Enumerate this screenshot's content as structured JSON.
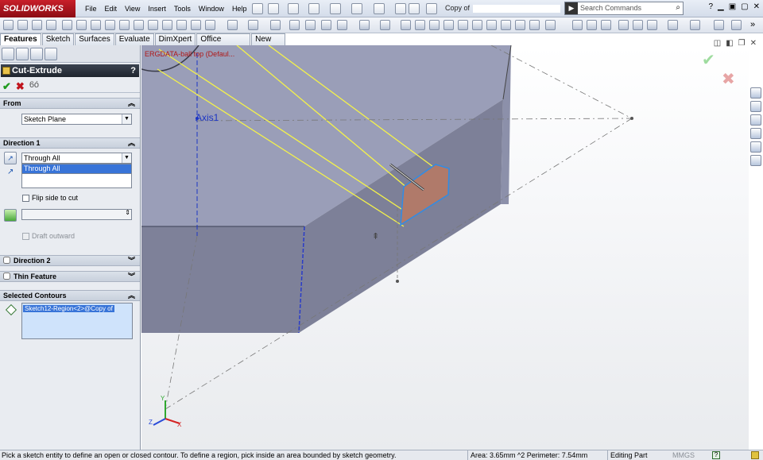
{
  "app": {
    "logo": "SOLIDWORKS",
    "menu": [
      "File",
      "Edit",
      "View",
      "Insert",
      "Tools",
      "Window",
      "Help"
    ],
    "document_title": "Copy of",
    "search_placeholder": "Search Commands"
  },
  "command_tabs": [
    "Features",
    "Sketch",
    "Surfaces",
    "Evaluate",
    "DimXpert",
    "Office Products",
    "New Tab"
  ],
  "property_manager": {
    "title": "Cut-Extrude",
    "help": "?",
    "from": {
      "heading": "From",
      "value": "Sketch Plane"
    },
    "direction1": {
      "heading": "Direction 1",
      "end_condition": "Through All",
      "dropdown_selected": "Through All",
      "flip_label": "Flip side to cut",
      "draft_label": "Draft outward"
    },
    "direction2": {
      "heading": "Direction 2"
    },
    "thin_feature": {
      "heading": "Thin Feature"
    },
    "selected_contours": {
      "heading": "Selected Contours",
      "items": [
        "Sketch12-Region<2>@Copy of"
      ]
    }
  },
  "graphics": {
    "tree_label": "ERGDATA-ball top  (Defaul...",
    "axis_label": "Axis1",
    "triad": {
      "x": "X",
      "y": "Y",
      "z": "Z"
    }
  },
  "status": {
    "message": "Pick a sketch entity to define an open or closed contour. To define a region, pick inside an area bounded by sketch geometry.",
    "measure": "Area: 3.65mm ^2 Perimeter: 7.54mm",
    "mode": "Editing Part",
    "units": "MMGS"
  },
  "colors": {
    "accent": "#3874d8",
    "ok": "#1f9a1f",
    "cancel": "#c0131d",
    "logo_red": "#c81f2a",
    "model_face": "#8e92ae",
    "sketch_yellow": "#f4f24a",
    "region_fill": "#b07a6a"
  }
}
